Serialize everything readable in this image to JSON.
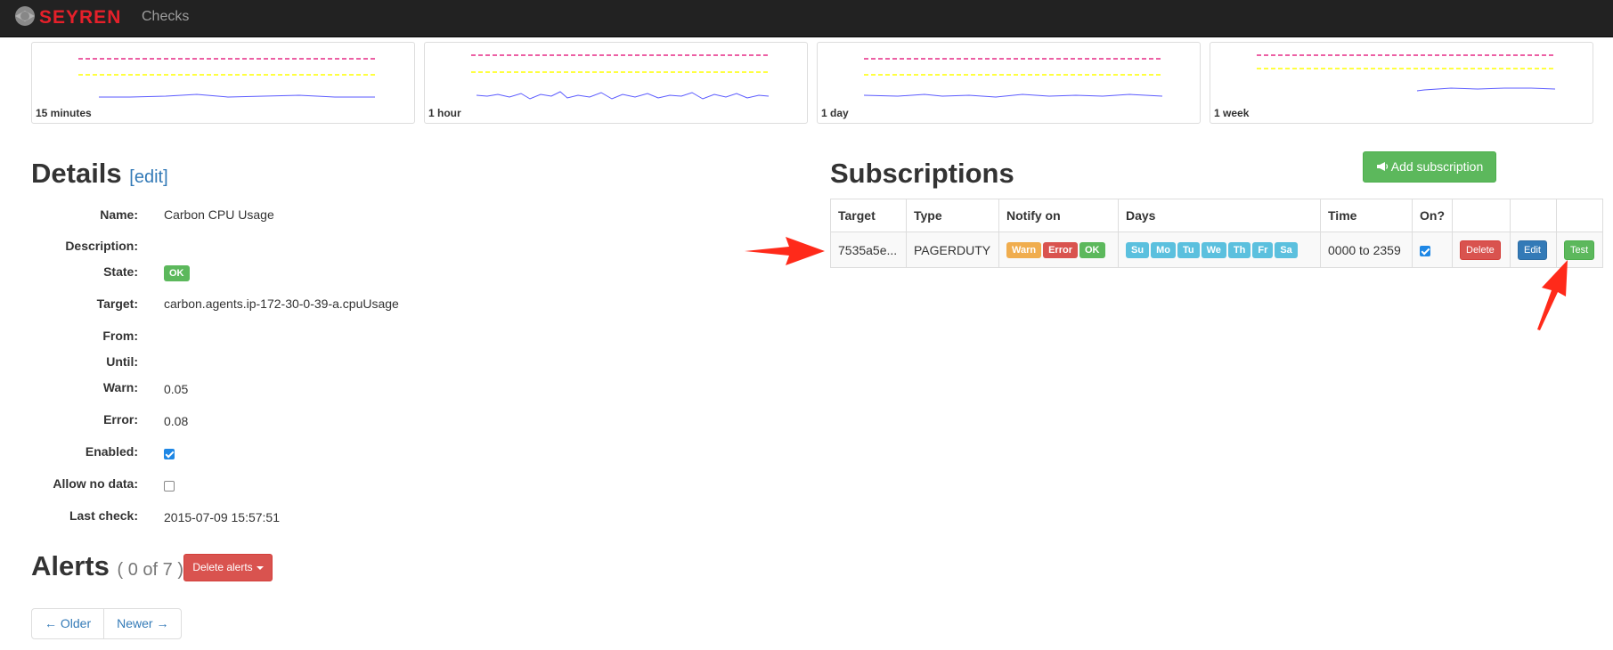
{
  "navbar": {
    "brand": "SEYREN",
    "nav_checks": "Checks"
  },
  "graphs": [
    {
      "label": "15 minutes"
    },
    {
      "label": "1 hour"
    },
    {
      "label": "1 day"
    },
    {
      "label": "1 week"
    }
  ],
  "details": {
    "title": "Details",
    "edit": "[edit]",
    "fields": {
      "name_label": "Name:",
      "name_value": "Carbon CPU Usage",
      "description_label": "Description:",
      "state_label": "State:",
      "state_value": "OK",
      "target_label": "Target:",
      "target_value": "carbon.agents.ip-172-30-0-39-a.cpuUsage",
      "from_label": "From:",
      "until_label": "Until:",
      "warn_label": "Warn:",
      "warn_value": "0.05",
      "error_label": "Error:",
      "error_value": "0.08",
      "enabled_label": "Enabled:",
      "enabled_checked": true,
      "allow_no_data_label": "Allow no data:",
      "allow_no_data_checked": false,
      "last_check_label": "Last check:",
      "last_check_value": "2015-07-09 15:57:51"
    }
  },
  "alerts": {
    "title": "Alerts",
    "count": "( 0 of 7 )",
    "delete_button": "Delete alerts",
    "older": "← Older",
    "newer": "Newer →"
  },
  "subscriptions": {
    "title": "Subscriptions",
    "add_button": "Add subscription",
    "headers": {
      "target": "Target",
      "type": "Type",
      "notify_on": "Notify on",
      "days": "Days",
      "time": "Time",
      "on": "On?"
    },
    "row": {
      "target": "7535a5e...",
      "type": "PAGERDUTY",
      "notify": {
        "warn": "Warn",
        "error": "Error",
        "ok": "OK"
      },
      "days": {
        "su": "Su",
        "mo": "Mo",
        "tu": "Tu",
        "we": "We",
        "th": "Th",
        "fr": "Fr",
        "sa": "Sa"
      },
      "time": "0000 to 2359",
      "on_checked": true,
      "delete": "Delete",
      "edit": "Edit",
      "test": "Test"
    }
  },
  "colors": {
    "navbar": "#222222",
    "success": "#5cb85c",
    "danger": "#d9534f",
    "warning": "#f0ad4e",
    "info": "#5bc0de",
    "primary": "#337ab7",
    "error_threshold": "#e0006e",
    "warn_threshold": "#ffff00",
    "series": "#5a5aff",
    "annotation_arrow": "#ff2a1a"
  },
  "icons": {
    "megaphone": "megaphone-icon",
    "arrows": "annotation-arrow-icon"
  }
}
